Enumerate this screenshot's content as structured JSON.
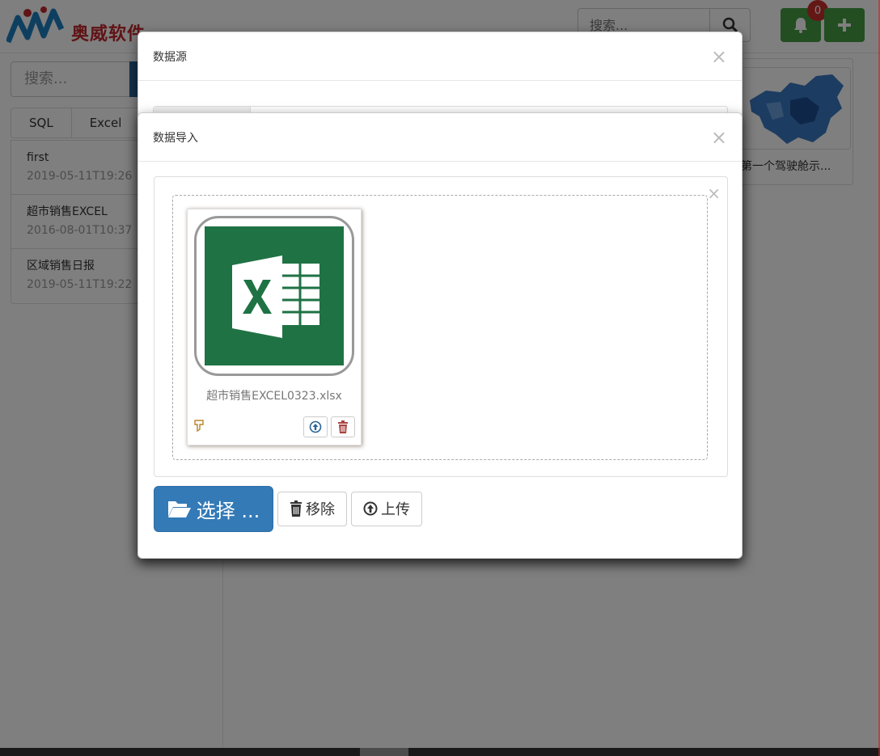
{
  "app": {
    "logo_text": "奥威软件",
    "search_placeholder": "搜索...",
    "notification_count": "0"
  },
  "sidebar": {
    "search_placeholder": "搜索...",
    "tabs": [
      "SQL",
      "Excel"
    ],
    "items": [
      {
        "name": "first",
        "date": "2019-05-11T19:26"
      },
      {
        "name": "超市销售EXCEL",
        "date": "2016-08-01T10:37"
      },
      {
        "name": "区域销售日报",
        "date": "2019-05-11T19:22"
      }
    ]
  },
  "dashboard_card": {
    "caption": "第一个驾驶舱示..."
  },
  "modal_datasource": {
    "title": "数据源",
    "close": "×"
  },
  "modal_import": {
    "title": "数据导入",
    "close": "×",
    "panel_close": "×",
    "file": {
      "name": "超市销售EXCEL0323.xlsx",
      "icon": "excel-file-icon"
    },
    "buttons": {
      "browse": "选择 ...",
      "remove": "移除",
      "upload": "上传"
    }
  },
  "colors": {
    "primary": "#337ab7",
    "success": "#449d44",
    "danger": "#c9302c",
    "excel_green": "#1f7244",
    "brand_red": "#c0282d"
  }
}
